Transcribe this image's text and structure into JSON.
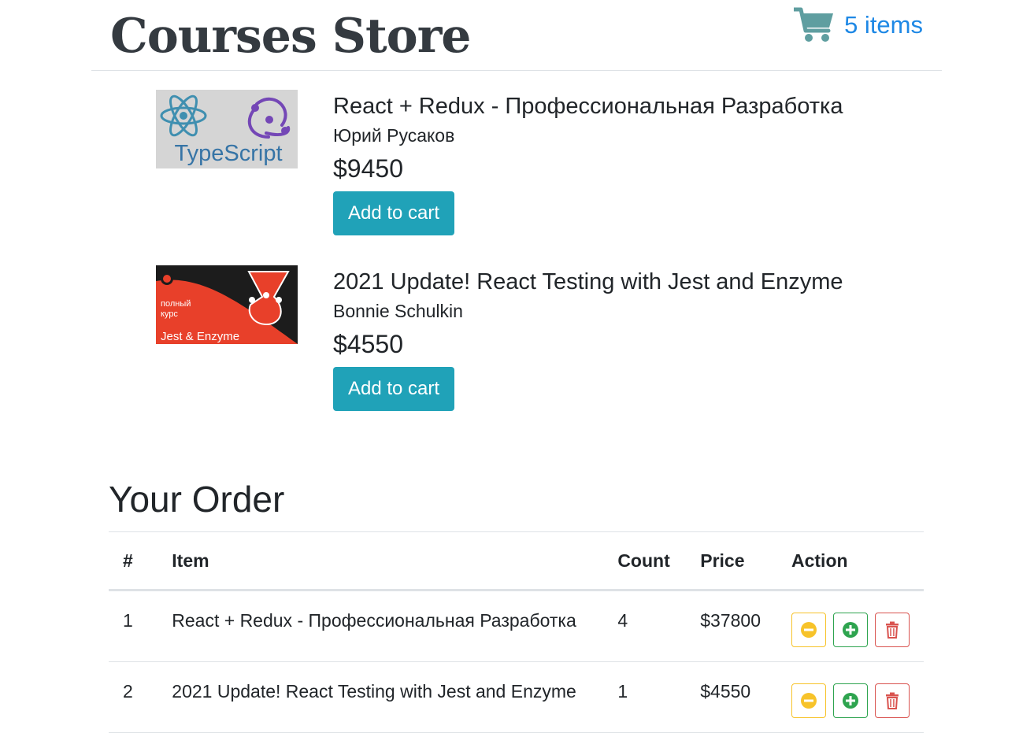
{
  "header": {
    "title": "Courses Store",
    "cart_label": "5 items",
    "cart_icon": "shopping-cart-icon"
  },
  "courses": [
    {
      "title": "React + Redux - Профессиональная Разработка",
      "author": "Юрий Русаков",
      "price": "$9450",
      "button": "Add to cart",
      "thumbnail_text": "TypeScript"
    },
    {
      "title": "2021 Update! React Testing with Jest and Enzyme",
      "author": "Bonnie Schulkin",
      "price": "$4550",
      "button": "Add to cart",
      "thumbnail_text": [
        "полный",
        "курс",
        "Jest & Enzyme"
      ]
    }
  ],
  "order": {
    "heading": "Your Order",
    "columns": [
      "#",
      "Item",
      "Count",
      "Price",
      "Action"
    ],
    "rows": [
      {
        "num": "1",
        "item": "React + Redux - Профессиональная Разработка",
        "count": "4",
        "price": "$37800"
      },
      {
        "num": "2",
        "item": "2021 Update! React Testing with Jest and Enzyme",
        "count": "1",
        "price": "$4550"
      }
    ],
    "action_icons": [
      "minus-circle-icon",
      "plus-circle-icon",
      "trash-icon"
    ]
  },
  "colors": {
    "accent": "#1e88e5",
    "button": "#20a2b8",
    "warning": "#f7c32a",
    "success": "#2ea44f",
    "danger": "#d9534f"
  }
}
